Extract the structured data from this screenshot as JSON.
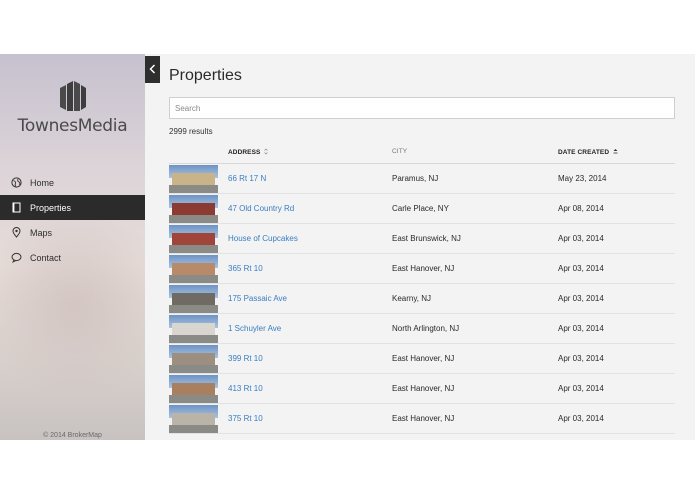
{
  "sidebar": {
    "logo_text": "TownesMedia",
    "items": [
      {
        "label": "Home",
        "icon": "globe-icon",
        "active": false
      },
      {
        "label": "Properties",
        "icon": "document-icon",
        "active": true
      },
      {
        "label": "Maps",
        "icon": "map-pin-icon",
        "active": false
      },
      {
        "label": "Contact",
        "icon": "chat-bubble-icon",
        "active": false
      }
    ],
    "footer": "© 2014 BrokerMap"
  },
  "main": {
    "title": "Properties",
    "search_placeholder": "Search",
    "results_count": "2999 results",
    "columns": {
      "address": "ADDRESS",
      "city": "CITY",
      "date_created": "DATE CREATED"
    },
    "sort": {
      "column": "date_created",
      "direction": "ascending-indicator"
    },
    "rows": [
      {
        "address": "66 Rt 17 N",
        "city": "Paramus, NJ",
        "date": "May 23, 2014",
        "thumb_color": "#c9b48a"
      },
      {
        "address": "47 Old Country Rd",
        "city": "Carle Place, NY",
        "date": "Apr 08, 2014",
        "thumb_color": "#8c3b33"
      },
      {
        "address": "House of Cupcakes",
        "city": "East Brunswick, NJ",
        "date": "Apr 03, 2014",
        "thumb_color": "#a0453a"
      },
      {
        "address": "365 Rt 10",
        "city": "East Hanover, NJ",
        "date": "Apr 03, 2014",
        "thumb_color": "#b88a6a"
      },
      {
        "address": "175 Passaic Ave",
        "city": "Kearny, NJ",
        "date": "Apr 03, 2014",
        "thumb_color": "#6f6a62"
      },
      {
        "address": "1 Schuyler Ave",
        "city": "North Arlington, NJ",
        "date": "Apr 03, 2014",
        "thumb_color": "#d9d6cf"
      },
      {
        "address": "399 Rt 10",
        "city": "East Hanover, NJ",
        "date": "Apr 03, 2014",
        "thumb_color": "#9c8f80"
      },
      {
        "address": "413 Rt 10",
        "city": "East Hanover, NJ",
        "date": "Apr 03, 2014",
        "thumb_color": "#a87f5f"
      },
      {
        "address": "375 Rt 10",
        "city": "East Hanover, NJ",
        "date": "Apr 03, 2014",
        "thumb_color": "#b9b3a8"
      }
    ]
  }
}
